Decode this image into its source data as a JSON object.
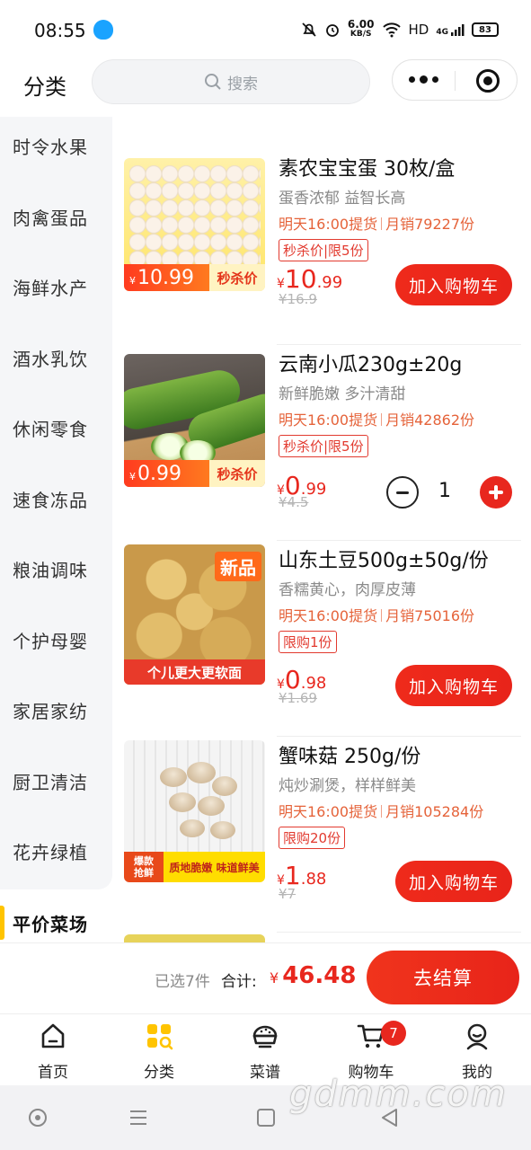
{
  "status_bar": {
    "time": "08:55",
    "net_speed_value": "6.00",
    "net_speed_unit": "KB/S",
    "hd_label": "HD",
    "signal_label": "4G",
    "battery": "83"
  },
  "header": {
    "title": "分类",
    "search_placeholder": "搜索"
  },
  "sidebar": {
    "items": [
      {
        "label": "时令水果"
      },
      {
        "label": "肉禽蛋品"
      },
      {
        "label": "海鲜水产"
      },
      {
        "label": "酒水乳饮"
      },
      {
        "label": "休闲零食"
      },
      {
        "label": "速食冻品"
      },
      {
        "label": "粮油调味"
      },
      {
        "label": "个护母婴"
      },
      {
        "label": "家居家纺"
      },
      {
        "label": "厨卫清洁"
      },
      {
        "label": "花卉绿植"
      }
    ],
    "active": "平价菜场"
  },
  "products": [
    {
      "name": "素农宝宝蛋 30枚/盒",
      "desc": "蛋香浓郁 益智长高",
      "pickup": "明天16:00提货",
      "sales": "月销79227份",
      "limit": "秒杀价|限5份",
      "price_currency": "¥",
      "price_int": "10",
      "price_dec": ".99",
      "old_price": "¥16.9",
      "tag_currency": "¥",
      "tag_price": "10.99",
      "tag_label": "秒杀价",
      "action": "加入购物车"
    },
    {
      "name": "云南小瓜230g±20g",
      "desc": "新鲜脆嫩 多汁清甜",
      "pickup": "明天16:00提货",
      "sales": "月销42862份",
      "limit": "秒杀价|限5份",
      "price_currency": "¥",
      "price_int": "0",
      "price_dec": ".99",
      "old_price": "¥4.5",
      "tag_currency": "¥",
      "tag_price": "0.99",
      "tag_label": "秒杀价",
      "quantity": "1"
    },
    {
      "name": "山东土豆500g±50g/份",
      "desc": "香糯黄心，肉厚皮薄",
      "pickup": "明天16:00提货",
      "sales": "月销75016份",
      "limit": "限购1份",
      "price_currency": "¥",
      "price_int": "0",
      "price_dec": ".98",
      "old_price": "¥1.69",
      "badge": "新品",
      "ribbon": "个儿更大更软面",
      "action": "加入购物车"
    },
    {
      "name": "蟹味菇 250g/份",
      "desc": "炖炒涮煲，样样鲜美",
      "pickup": "明天16:00提货",
      "sales": "月销105284份",
      "limit": "限购20份",
      "price_currency": "¥",
      "price_int": "1",
      "price_dec": ".88",
      "old_price": "¥7",
      "ribbon_left_1": "爆款",
      "ribbon_left_2": "抢鲜",
      "ribbon_right": "质地脆嫩 味道鲜美",
      "action": "加入购物车"
    }
  ],
  "checkout": {
    "selected": "已选7件",
    "total_label": "合计:",
    "currency": "¥",
    "total": "46.48",
    "button": "去结算"
  },
  "tabbar": {
    "items": [
      {
        "label": "首页",
        "icon": "home-icon"
      },
      {
        "label": "分类",
        "icon": "category-icon"
      },
      {
        "label": "菜谱",
        "icon": "recipe-icon"
      },
      {
        "label": "购物车",
        "icon": "cart-icon"
      },
      {
        "label": "我的",
        "icon": "profile-icon"
      }
    ],
    "active": "分类",
    "cart_badge": "7"
  },
  "watermark": "gdmm.com",
  "colors": {
    "accent_red": "#e8271e",
    "accent_yellow": "#ffc400",
    "meta_orange": "#e5633a"
  }
}
